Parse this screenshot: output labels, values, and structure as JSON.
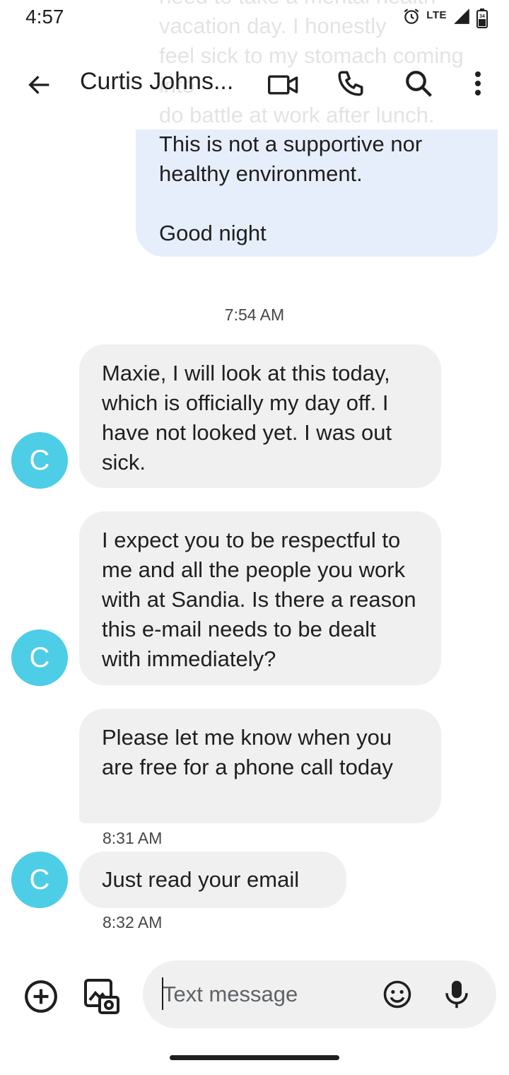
{
  "status_bar": {
    "time": "4:57",
    "network": "LTE",
    "battery": "34"
  },
  "header": {
    "title": "Curtis Johns..."
  },
  "faded_message": {
    "text": "need to take a mental health\nvacation day. I honestly\nfeel sick to my stomach coming into\ndo battle at work after lunch."
  },
  "messages": [
    {
      "direction": "outgoing",
      "text": "This is not a supportive nor\nhealthy environment.\n\nGood night"
    },
    {
      "type": "timestamp",
      "text": "7:54 AM"
    },
    {
      "direction": "incoming",
      "avatar_letter": "C",
      "text": "Maxie, I will look at this today, which is officially my day off. I have not looked yet. I was out sick."
    },
    {
      "direction": "incoming",
      "avatar_letter": "C",
      "text": "I expect you to be respectful to me and all the people you work with at Sandia. Is there a reason this e-mail needs to be dealt with immediately?"
    },
    {
      "direction": "incoming",
      "text": "Please let me know when you are free for a phone call today",
      "time": "8:31 AM"
    },
    {
      "direction": "incoming",
      "avatar_letter": "C",
      "text": "Just read your email",
      "time": "8:32 AM"
    }
  ],
  "compose": {
    "placeholder": "Text message"
  },
  "colors": {
    "avatar": "#4ecde6",
    "outgoing_bubble": "#e6eefc",
    "incoming_bubble": "#f0f0f0"
  }
}
